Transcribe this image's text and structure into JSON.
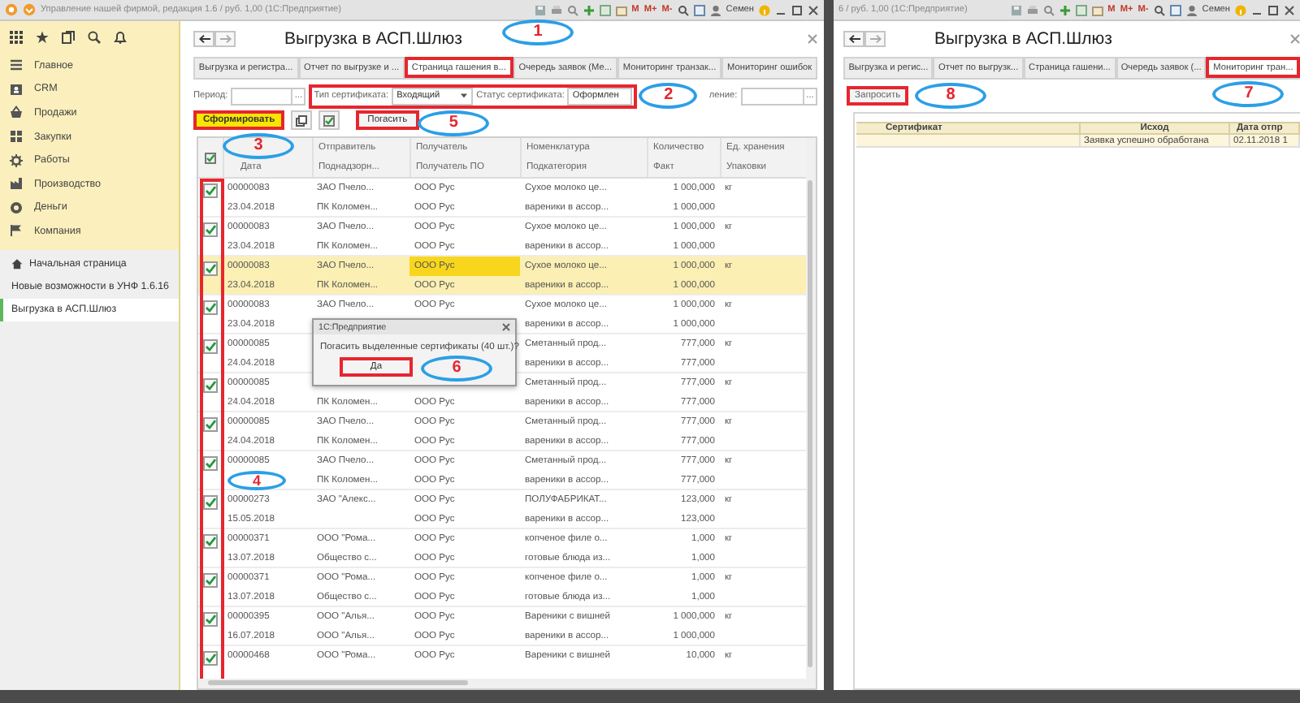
{
  "main_window": {
    "title_bar": {
      "title": "Управление нашей фирмой, редакция 1.6 / руб. 1,00 (1С:Предприятие)",
      "memory_buttons": [
        "M",
        "M+",
        "M-"
      ],
      "user": "Семен"
    },
    "sidebar": {
      "sections": [
        {
          "label": "Главное"
        },
        {
          "label": "CRM"
        },
        {
          "label": "Продажи"
        },
        {
          "label": "Закупки"
        },
        {
          "label": "Работы"
        },
        {
          "label": "Производство"
        },
        {
          "label": "Деньги"
        },
        {
          "label": "Компания"
        }
      ],
      "open_windows": [
        {
          "label": "Начальная страница",
          "selected": false
        },
        {
          "label": "Новые возможности в УНФ 1.6.16",
          "selected": false
        },
        {
          "label": "Выгрузка в АСП.Шлюз",
          "selected": true
        }
      ]
    },
    "form": {
      "title": "Выгрузка в АСП.Шлюз",
      "tabs": [
        {
          "label": "Выгрузка и регистра...",
          "selected": false,
          "highlighted": false
        },
        {
          "label": "Отчет по выгрузке и ...",
          "selected": false,
          "highlighted": false
        },
        {
          "label": "Страница гашения в...",
          "selected": true,
          "highlighted": true,
          "callout": "1"
        },
        {
          "label": "Очередь заявок (Ме...",
          "selected": false,
          "highlighted": false
        },
        {
          "label": "Мониторинг транзак...",
          "selected": false,
          "highlighted": false
        },
        {
          "label": "Мониторинг ошибок",
          "selected": false,
          "highlighted": false
        }
      ],
      "filters": {
        "period": {
          "label": "Период:",
          "choose_button": "..."
        },
        "certificate": {
          "highlighted": true,
          "callout": "2",
          "type_label": "Тип сертификата:",
          "type_value": "Входящий",
          "status_label": "Статус сертификата:",
          "status_value": "Оформлен"
        },
        "display": {
          "label": "ление:",
          "choose_button": "..."
        }
      },
      "toolbar": {
        "generate_button": {
          "label": "Сформировать",
          "highlighted": true,
          "callout": "3"
        },
        "redeem_button": {
          "label": "Погасить",
          "highlighted": true,
          "callout": "5"
        }
      },
      "table": {
        "checkbox_column": {
          "highlighted": true,
          "callout": "4"
        },
        "columns": [
          {
            "bottom": "Дата"
          },
          {
            "top": "Отправитель",
            "bottom": "Поднадзорн..."
          },
          {
            "top": "Получатель",
            "bottom": "Получатель ПО"
          },
          {
            "top": "Номенклатура",
            "bottom": "Подкатегория"
          },
          {
            "top": "Количество",
            "bottom": "Факт"
          },
          {
            "top": "Ед. хранения",
            "bottom": "Упаковки"
          }
        ],
        "rows": [
          {
            "checked": true,
            "selected": false,
            "line1": {
              "number": "00000083",
              "sender": "ЗАО Пчело...",
              "recipient": "ООО Рус",
              "nomenclature": "Сухое молоко це...",
              "quantity": "1 000,000",
              "unit": "кг"
            },
            "line2": {
              "date": "23.04.2018",
              "supervised": "ПК Коломен...",
              "recipient_po": "ООО Рус",
              "subcategory": "вареники в ассор...",
              "fact": "1 000,000"
            }
          },
          {
            "checked": true,
            "selected": false,
            "line1": {
              "number": "00000083",
              "sender": "ЗАО Пчело...",
              "recipient": "ООО Рус",
              "nomenclature": "Сухое молоко це...",
              "quantity": "1 000,000",
              "unit": "кг"
            },
            "line2": {
              "date": "23.04.2018",
              "supervised": "ПК Коломен...",
              "recipient_po": "ООО Рус",
              "subcategory": "вареники в ассор...",
              "fact": "1 000,000"
            }
          },
          {
            "checked": true,
            "selected": true,
            "line1": {
              "number": "00000083",
              "sender": "ЗАО Пчело...",
              "recipient": {
                "text": "ООО Рус",
                "focused": true
              },
              "nomenclature": "Сухое молоко це...",
              "quantity": "1 000,000",
              "unit": "кг"
            },
            "line2": {
              "date": "23.04.2018",
              "supervised": "ПК Коломен...",
              "recipient_po": "ООО Рус",
              "subcategory": "вареники в ассор...",
              "fact": "1 000,000"
            }
          },
          {
            "checked": true,
            "selected": false,
            "line1": {
              "number": "00000083",
              "sender": "ЗАО Пчело...",
              "recipient": "ООО Рус",
              "nomenclature": "Сухое молоко це...",
              "quantity": "1 000,000",
              "unit": "кг"
            },
            "line2": {
              "date": "23.04.2018",
              "subcategory": "вареники в ассор...",
              "fact": "1 000,000"
            }
          },
          {
            "checked": true,
            "selected": false,
            "line1": {
              "number": "00000085",
              "nomenclature": "Сметанный прод...",
              "quantity": "777,000",
              "unit": "кг"
            },
            "line2": {
              "date": "24.04.2018",
              "subcategory": "вареники в ассор...",
              "fact": "777,000"
            }
          },
          {
            "checked": true,
            "selected": false,
            "line1": {
              "number": "00000085",
              "nomenclature": "Сметанный прод...",
              "quantity": "777,000",
              "unit": "кг"
            },
            "line2": {
              "date": "24.04.2018",
              "supervised": "ПК Коломен...",
              "recipient_po": "ООО Рус",
              "subcategory": "вареники в ассор...",
              "fact": "777,000"
            }
          },
          {
            "checked": true,
            "selected": false,
            "line1": {
              "number": "00000085",
              "sender": "ЗАО Пчело...",
              "recipient": "ООО Рус",
              "nomenclature": "Сметанный прод...",
              "quantity": "777,000",
              "unit": "кг"
            },
            "line2": {
              "date": "24.04.2018",
              "supervised": "ПК Коломен...",
              "recipient_po": "ООО Рус",
              "subcategory": "вареники в ассор...",
              "fact": "777,000"
            }
          },
          {
            "checked": true,
            "selected": false,
            "line1": {
              "number": "00000085",
              "sender": "ЗАО Пчело...",
              "recipient": "ООО Рус",
              "nomenclature": "Сметанный прод...",
              "quantity": "777,000",
              "unit": "кг"
            },
            "line2": {
              "supervised": "ПК Коломен...",
              "recipient_po": "ООО Рус",
              "subcategory": "вареники в ассор...",
              "fact": "777,000"
            }
          },
          {
            "checked": true,
            "selected": false,
            "line1": {
              "number": "00000273",
              "sender": "ЗАО \"Алекс...",
              "recipient": "ООО Рус",
              "nomenclature": "ПОЛУФАБРИКАТ...",
              "quantity": "123,000",
              "unit": "кг"
            },
            "line2": {
              "date": "15.05.2018",
              "recipient_po": "ООО Рус",
              "subcategory": "вареники в ассор...",
              "fact": "123,000"
            }
          },
          {
            "checked": true,
            "selected": false,
            "line1": {
              "number": "00000371",
              "sender": "ООО \"Рома...",
              "recipient": "ООО Рус",
              "nomenclature": "копченое филе о...",
              "quantity": "1,000",
              "unit": "кг"
            },
            "line2": {
              "date": "13.07.2018",
              "supervised": "Общество с...",
              "recipient_po": "ООО Рус",
              "subcategory": "готовые блюда из...",
              "fact": "1,000"
            }
          },
          {
            "checked": true,
            "selected": false,
            "line1": {
              "number": "00000371",
              "sender": "ООО \"Рома...",
              "recipient": "ООО Рус",
              "nomenclature": "копченое филе о...",
              "quantity": "1,000",
              "unit": "кг"
            },
            "line2": {
              "date": "13.07.2018",
              "supervised": "Общество с...",
              "recipient_po": "ООО Рус",
              "subcategory": "готовые блюда из...",
              "fact": "1,000"
            }
          },
          {
            "checked": true,
            "selected": false,
            "line1": {
              "number": "00000395",
              "sender": "ООО \"Алья...",
              "recipient": "ООО Рус",
              "nomenclature": "Вареники с вишней",
              "quantity": "1 000,000",
              "unit": "кг"
            },
            "line2": {
              "date": "16.07.2018",
              "supervised": "ООО \"Алья...",
              "recipient_po": "ООО Рус",
              "subcategory": "вареники в ассор...",
              "fact": "1 000,000"
            }
          },
          {
            "checked": true,
            "selected": false,
            "line1": {
              "number": "00000468",
              "sender": "ООО \"Рома...",
              "recipient": "ООО Рус",
              "nomenclature": "Вареники с вишней",
              "quantity": "10,000",
              "unit": "кг"
            }
          }
        ]
      },
      "dialog": {
        "title": "1С:Предприятие",
        "message": "Погасить выделенные сертификаты (40 шт.)?",
        "buttons": [
          {
            "label": "Да",
            "highlighted": true
          }
        ],
        "callout": "6"
      }
    }
  },
  "second_window": {
    "title_bar": {
      "title": "6 / руб. 1,00 (1С:Предприятие)",
      "memory_buttons": [
        "M",
        "M+",
        "M-"
      ],
      "user": "Семен"
    },
    "form": {
      "title": "Выгрузка в АСП.Шлюз",
      "tabs": [
        {
          "label": "Выгрузка и регис...",
          "selected": false,
          "highlighted": false
        },
        {
          "label": "Отчет по выгрузк...",
          "selected": false,
          "highlighted": false
        },
        {
          "label": "Страница гашени...",
          "selected": false,
          "highlighted": false
        },
        {
          "label": "Очередь заявок (...",
          "selected": false,
          "highlighted": false
        },
        {
          "label": "Мониторинг тран...",
          "selected": true,
          "highlighted": true,
          "callout": "7"
        }
      ],
      "request_button": {
        "label": "Запросить",
        "highlighted": true,
        "callout": "8"
      },
      "table": {
        "columns": [
          "Сертификат",
          "Исход",
          "Дата отпр"
        ],
        "rows": [
          {
            "selected": true,
            "outcome": "Заявка успешно обработана",
            "sent_date": "02.11.2018 1"
          }
        ]
      }
    }
  }
}
